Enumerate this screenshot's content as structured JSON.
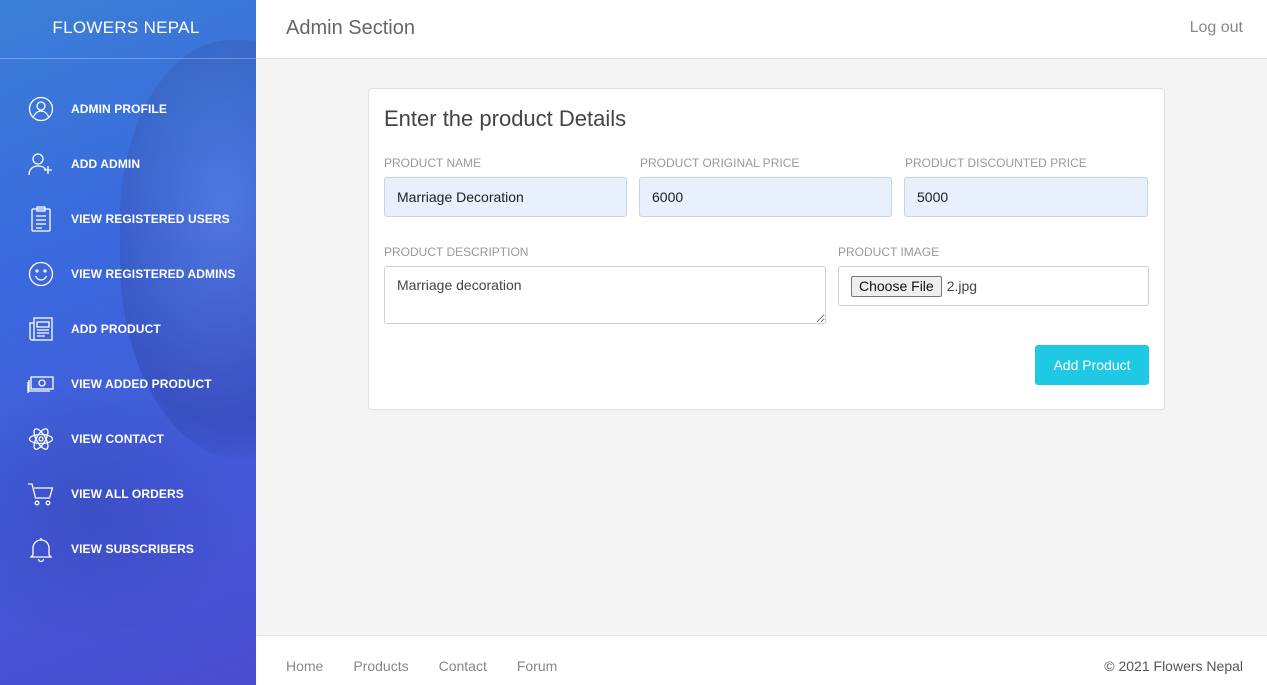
{
  "sidebar": {
    "brand": "FLOWERS NEPAL",
    "items": [
      {
        "label": "ADMIN PROFILE",
        "icon": "user-circle-icon"
      },
      {
        "label": "ADD ADMIN",
        "icon": "user-plus-icon"
      },
      {
        "label": "VIEW REGISTERED USERS",
        "icon": "clipboard-icon"
      },
      {
        "label": "VIEW REGISTERED ADMINS",
        "icon": "smiley-icon"
      },
      {
        "label": "ADD PRODUCT",
        "icon": "newspaper-icon"
      },
      {
        "label": "VIEW ADDED PRODUCT",
        "icon": "money-icon"
      },
      {
        "label": "VIEW CONTACT",
        "icon": "atom-icon"
      },
      {
        "label": "VIEW ALL ORDERS",
        "icon": "cart-icon"
      },
      {
        "label": "VIEW SUBSCRIBERS",
        "icon": "bell-icon"
      }
    ]
  },
  "header": {
    "title": "Admin Section",
    "logout": "Log out"
  },
  "form": {
    "title": "Enter the product Details",
    "name_label": "PRODUCT NAME",
    "name_value": "Marriage Decoration",
    "original_price_label": "PRODUCT ORIGINAL PRICE",
    "original_price_value": "6000",
    "discounted_price_label": "PRODUCT DISCOUNTED PRICE",
    "discounted_price_value": "5000",
    "description_label": "PRODUCT DESCRIPTION",
    "description_value": "Marriage decoration",
    "image_label": "PRODUCT IMAGE",
    "file_button": "Choose File",
    "file_name": "2.jpg",
    "submit": "Add Product"
  },
  "footer": {
    "links": [
      "Home",
      "Products",
      "Contact",
      "Forum"
    ],
    "copyright": "© 2021 Flowers Nepal"
  },
  "colors": {
    "sidebar_gradient_start": "#3b7fd6",
    "sidebar_gradient_end": "#4a4cd0",
    "submit_button": "#1fc8e3",
    "autofill_input": "#e8f0fe"
  }
}
